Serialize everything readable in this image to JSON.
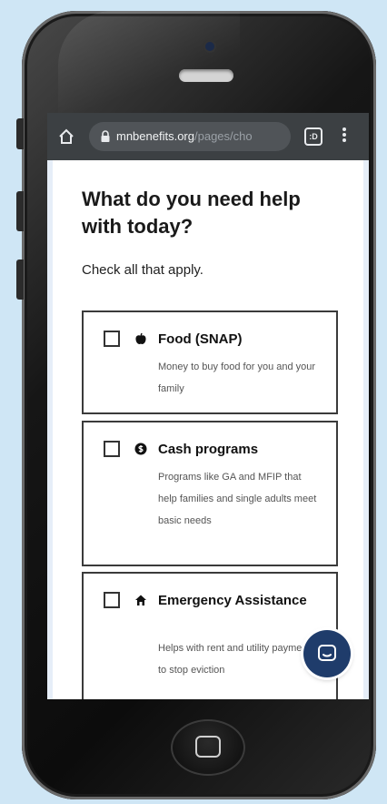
{
  "browser": {
    "url_domain": "mnbenefits.org",
    "url_path": "/pages/cho",
    "tabs_count": ":D"
  },
  "page": {
    "title": "What do you need help with today?",
    "hint": "Check all that apply."
  },
  "options": [
    {
      "title": "Food (SNAP)",
      "description": "Money to buy food for you and your family",
      "icon": "apple-icon",
      "checked": false
    },
    {
      "title": "Cash programs",
      "description": "Programs like GA and MFIP that help families and single adults meet basic needs",
      "icon": "coin-icon",
      "checked": false
    },
    {
      "title": "Emergency Assistance",
      "description": "Helps with rent and utility payments to stop eviction",
      "icon": "house-icon",
      "checked": false
    }
  ],
  "colors": {
    "background": "#cfe6f5",
    "browser_bar": "#3c4043",
    "chat_button": "#1f3c6b",
    "option_border": "#3b3b3b"
  }
}
